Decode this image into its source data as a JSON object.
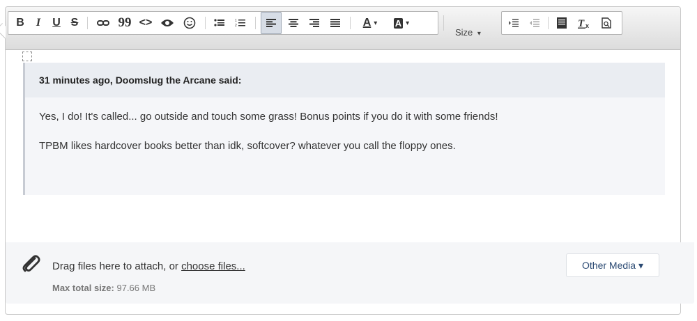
{
  "toolbar": {
    "bold": "B",
    "italic": "I",
    "underline": "U",
    "strike": "S",
    "quote": "99",
    "code": "<>",
    "size_label": "Size",
    "size_caret": "▾",
    "text_color": "A",
    "bg_color": "A",
    "caret": "▾"
  },
  "content": {
    "quote": {
      "header": "31 minutes ago, Doomslug the Arcane said:",
      "line1": "Yes, I do! It's called... go outside and touch some grass! Bonus points if you do it with some friends!",
      "line2": "TPBM likes hardcover books better than idk, softcover? whatever you call the floppy ones."
    }
  },
  "attach": {
    "drag_text": "Drag files here to attach, or ",
    "choose_link": "choose files...",
    "max_label": "Max total size:",
    "max_value": "97.66 MB",
    "other_media": "Other Media ▾"
  },
  "colors": {
    "toolbar_top": "#f6f6f6",
    "toolbar_bottom": "#dcdcdc",
    "quote_bg": "#f5f6f9",
    "quote_head_bg": "#eaedf2",
    "link": "#2b4a73"
  },
  "icons": [
    "link-icon",
    "preview-icon",
    "emoji-icon",
    "bullet-list-icon",
    "numbered-list-icon",
    "align-left-icon",
    "align-center-icon",
    "align-right-icon",
    "justify-icon",
    "indent-icon",
    "outdent-icon",
    "source-icon",
    "remove-format-icon",
    "find-icon",
    "paperclip-icon",
    "anchor-icon"
  ]
}
